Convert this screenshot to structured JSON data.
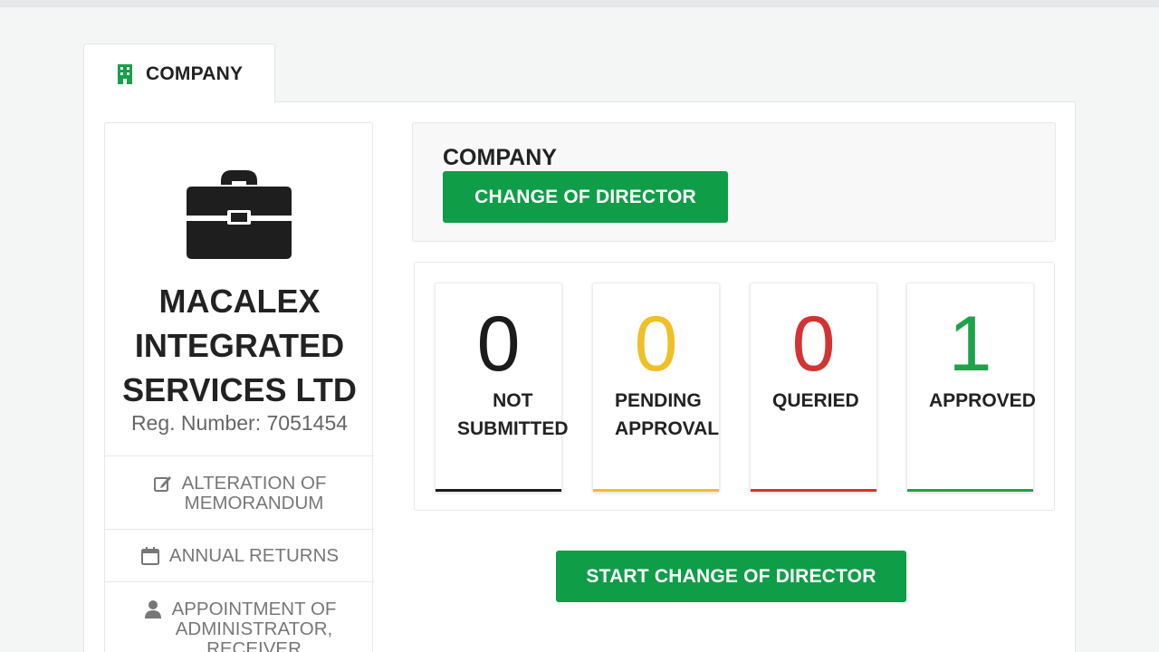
{
  "tab": {
    "label": "COMPANY",
    "icon": "building-icon"
  },
  "company": {
    "name_lines": [
      "MACALEX",
      "INTEGRATED",
      "SERVICES LTD"
    ],
    "reg_number": "Reg. Number: 7051454"
  },
  "menu": {
    "items": [
      {
        "label_lines": [
          "ALTERATION OF",
          "MEMORANDUM"
        ],
        "icon": "edit-icon"
      },
      {
        "label_lines": [
          "ANNUAL RETURNS"
        ],
        "icon": "calendar-icon"
      },
      {
        "label_lines": [
          "APPOINTMENT OF",
          "ADMINISTRATOR,",
          "RECEIVER"
        ],
        "icon": "user-icon"
      }
    ]
  },
  "header": {
    "title": "COMPANY",
    "button_label": "CHANGE OF DIRECTOR"
  },
  "stats": [
    {
      "count": "0",
      "label_lines": [
        "NOT",
        "SUBMITTED"
      ],
      "color": "#1b1b1b"
    },
    {
      "count": "0",
      "label_lines": [
        "PENDING",
        "APPROVAL"
      ],
      "color": "#efc027"
    },
    {
      "count": "0",
      "label_lines": [
        "QUERIED"
      ],
      "color": "#d33431"
    },
    {
      "count": "1",
      "label_lines": [
        "APPROVED"
      ],
      "color": "#1fa24a"
    }
  ],
  "start_button_label": "START CHANGE OF DIRECTOR",
  "colors": {
    "accent": "#109d48"
  }
}
